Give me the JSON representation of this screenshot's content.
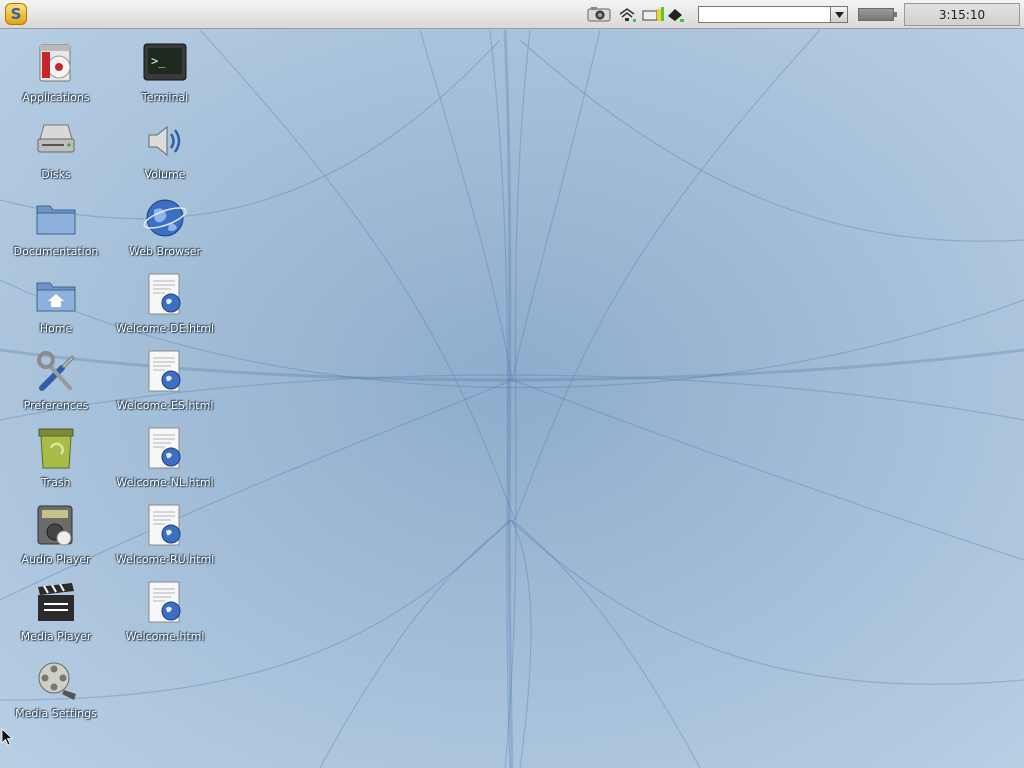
{
  "panel": {
    "menu_button_letter": "S",
    "clock": "3:15:10",
    "search_value": ""
  },
  "desktop": {
    "icons": [
      {
        "label": "Applications",
        "icon": "applications-icon"
      },
      {
        "label": "Terminal",
        "icon": "terminal-icon"
      },
      {
        "label": "Disks",
        "icon": "disk-icon"
      },
      {
        "label": "Volume",
        "icon": "speaker-icon"
      },
      {
        "label": "Documentation",
        "icon": "folder-icon"
      },
      {
        "label": "Web Browser",
        "icon": "globe-icon"
      },
      {
        "label": "Home",
        "icon": "home-folder-icon"
      },
      {
        "label": "Welcome-DE.html",
        "icon": "html-document-icon"
      },
      {
        "label": "Preferences",
        "icon": "tools-icon"
      },
      {
        "label": "Welcome-ES.html",
        "icon": "html-document-icon"
      },
      {
        "label": "Trash",
        "icon": "trash-icon"
      },
      {
        "label": "Welcome-NL.html",
        "icon": "html-document-icon"
      },
      {
        "label": "Audio Player",
        "icon": "audio-player-icon"
      },
      {
        "label": "Welcome-RU.html",
        "icon": "html-document-icon"
      },
      {
        "label": "Media Player",
        "icon": "clapperboard-icon"
      },
      {
        "label": "Welcome.html",
        "icon": "html-document-icon"
      },
      {
        "label": "Media Settings",
        "icon": "film-reel-icon"
      }
    ]
  },
  "colors": {
    "wallpaper": "#a9c2da",
    "wallpaper_lines": "#4f7cab"
  }
}
